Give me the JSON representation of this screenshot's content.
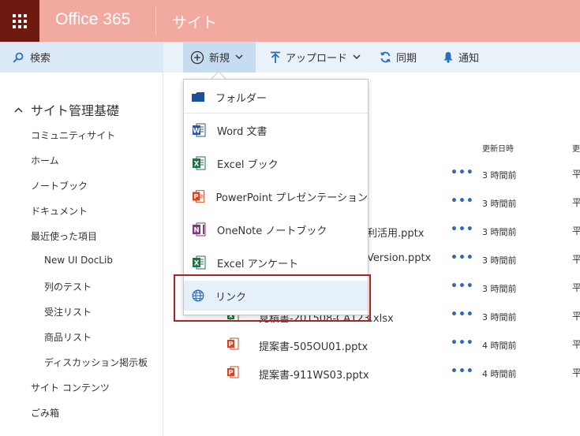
{
  "suite": {
    "brand": "Office 365",
    "section": "サイト"
  },
  "search": {
    "label": "検索"
  },
  "commands": [
    {
      "label": "新規",
      "icon": "plus-circle-icon"
    },
    {
      "label": "アップロード",
      "icon": "upload-arrow-icon"
    },
    {
      "label": "同期",
      "icon": "sync-icon"
    },
    {
      "label": "通知",
      "icon": "bell-icon"
    }
  ],
  "nav": {
    "heading": "サイト管理基礎",
    "items": [
      "コミュニティサイト",
      "ホーム",
      "ノートブック",
      "ドキュメント",
      "最近使った項目",
      "New UI DocLib",
      "列のテスト",
      "受注リスト",
      "商品リスト",
      "ディスカッション掲示板",
      "サイト コンテンツ",
      "ごみ箱"
    ]
  },
  "list": {
    "col_modified": "更新日時",
    "col_modified_by": "更",
    "rows": [
      {
        "name": "",
        "time": "3 時間前",
        "by": "平",
        "type": "none"
      },
      {
        "name": "",
        "time": "3 時間前",
        "by": "平",
        "type": "none"
      },
      {
        "name": "利活用.pptx",
        "time": "3 時間前",
        "by": "平",
        "type": "none"
      },
      {
        "name": "Version.pptx",
        "time": "3 時間前",
        "by": "平",
        "type": "none"
      },
      {
        "name": "",
        "time": "3 時間前",
        "by": "平",
        "type": "none"
      },
      {
        "name": "見積書-201508-CA123.xlsx",
        "time": "3 時間前",
        "by": "平",
        "type": "excel"
      },
      {
        "name": "提案書-505OU01.pptx",
        "time": "4 時間前",
        "by": "平",
        "type": "powerpoint"
      },
      {
        "name": "提案書-911WS03.pptx",
        "time": "4 時間前",
        "by": "平",
        "type": "powerpoint"
      }
    ]
  },
  "menu": {
    "items": [
      {
        "label": "フォルダー",
        "icon": "folder-icon"
      },
      {
        "label": "Word 文書",
        "icon": "word-icon"
      },
      {
        "label": "Excel ブック",
        "icon": "excel-icon"
      },
      {
        "label": "PowerPoint プレゼンテーション",
        "icon": "powerpoint-icon"
      },
      {
        "label": "OneNote ノートブック",
        "icon": "onenote-icon"
      },
      {
        "label": "Excel アンケート",
        "icon": "excel-survey-icon"
      },
      {
        "label": "リンク",
        "icon": "globe-icon"
      }
    ]
  },
  "colors": {
    "suite_bar": "#f2a9a0",
    "waffle": "#6f1a10",
    "accent": "#2a6ebb",
    "word": "#2b579a",
    "excel": "#217346",
    "powerpoint": "#d24726",
    "onenote": "#80397b",
    "highlight_border": "#b02020"
  }
}
